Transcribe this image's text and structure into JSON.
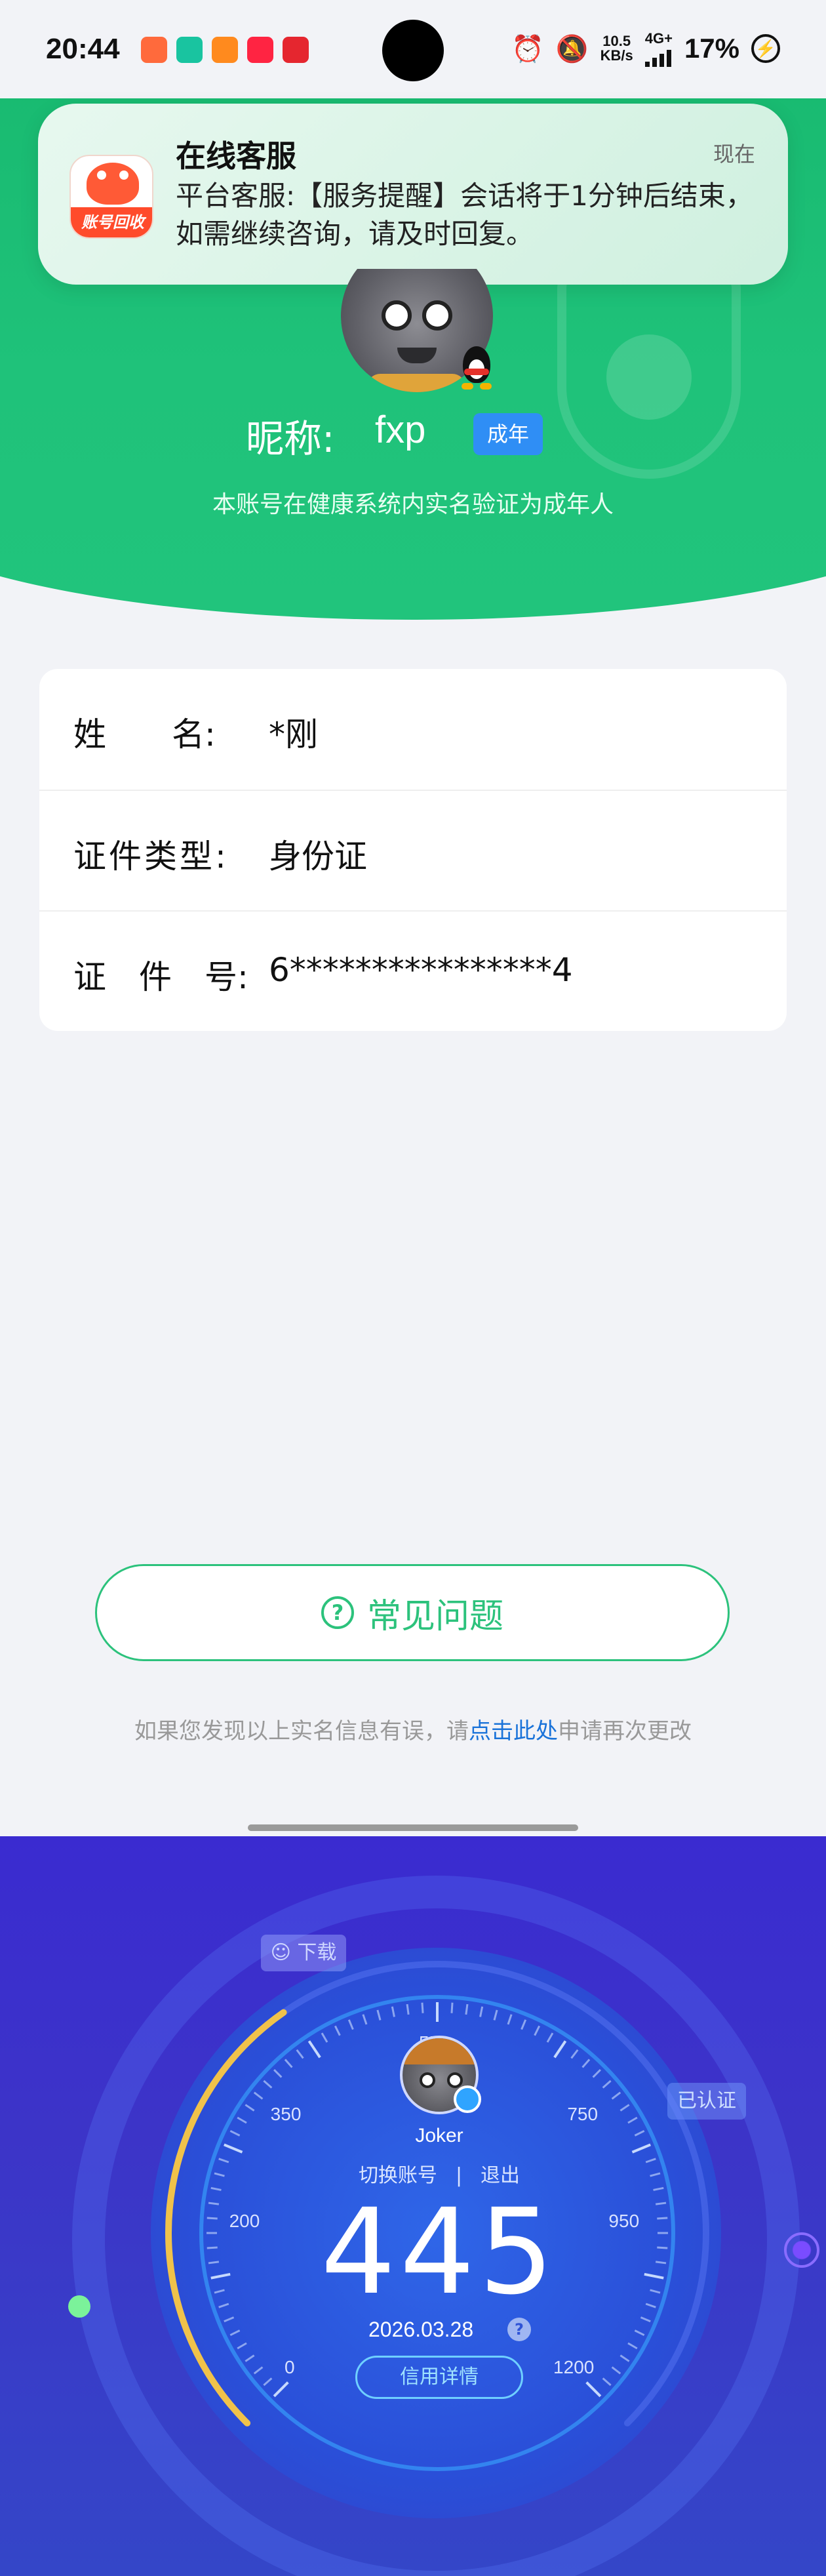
{
  "status_bar": {
    "time": "20:44",
    "net_speed_value": "10.5",
    "net_speed_unit": "KB/s",
    "network_type": "4G+",
    "battery": "17%"
  },
  "notification": {
    "app_icon_text": "账号回收",
    "title": "在线客服",
    "time": "现在",
    "body": "平台客服:【服务提醒】会话将于1分钟后结束，如需继续咨询，请及时回复。"
  },
  "profile": {
    "nickname_label": "昵称:",
    "nickname": "fxp",
    "badge": "成年",
    "verify_text": "本账号在健康系统内实名验证为成年人"
  },
  "info": {
    "rows": [
      {
        "label": "姓　　名:",
        "value": "*刚"
      },
      {
        "label": "证件类型:",
        "value": "身份证"
      },
      {
        "label": "证　件　号:",
        "value": "6****************4"
      }
    ]
  },
  "faq": {
    "icon": "?",
    "label": "常见问题"
  },
  "hint": {
    "prefix": "如果您发现以上实名信息有误，请",
    "link": "点击此处",
    "suffix": "申请再次更改"
  },
  "credit": {
    "bubble_left": "☺ 下载",
    "bubble_right": "已认证",
    "gauge_labels": [
      "0",
      "200",
      "350",
      "550",
      "750",
      "950",
      "1200"
    ],
    "user_name": "Joker",
    "switch_account": "切换账号",
    "separator": "|",
    "logout": "退出",
    "score": "445",
    "score_max": 1200,
    "date": "2026.03.28",
    "date_help": "?",
    "detail_button": "信用详情"
  },
  "colors": {
    "brand_green": "#21c47c",
    "link_blue": "#1a73d9",
    "badge_blue": "#2f8ef5"
  }
}
